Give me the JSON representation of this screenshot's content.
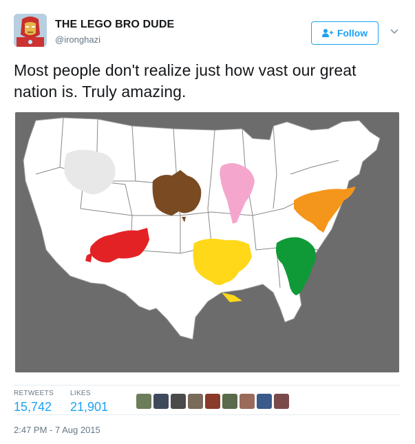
{
  "author": {
    "display_name": "THE LEGO BRO DUDE",
    "handle": "@ironghazi",
    "avatar_icon": "iron-man-avatar-icon"
  },
  "follow_button": {
    "label": "Follow",
    "icon": "add-user-icon"
  },
  "menu_caret_icon": "chevron-down-icon",
  "tweet": {
    "text": "Most people don't realize just how vast our great nation is. Truly amazing."
  },
  "media": {
    "description_icon": "us-map-with-continents-image",
    "colors": {
      "antarctica": "#e8e8e8",
      "australia": "#7a4a22",
      "south_america": "#f5a6cd",
      "north_america": "#f5961c",
      "europe": "#e32226",
      "asia": "#ffd819",
      "africa": "#0f9a37",
      "background": "#6c6c6c",
      "land": "#ffffff"
    }
  },
  "stats": {
    "retweets_label": "RETWEETS",
    "retweets_count": "15,742",
    "likes_label": "LIKES",
    "likes_count": "21,901"
  },
  "likers": [
    {
      "color": "#6b7d5a"
    },
    {
      "color": "#3e4a5c"
    },
    {
      "color": "#4a4a4a"
    },
    {
      "color": "#7a6a5a"
    },
    {
      "color": "#8a3a2a"
    },
    {
      "color": "#5a6a4a"
    },
    {
      "color": "#9a6a5a"
    },
    {
      "color": "#3a5a8a"
    },
    {
      "color": "#7a4a4a"
    }
  ],
  "timestamp": "2:47 PM - 7 Aug 2015",
  "accent_color": "#1da1f2"
}
